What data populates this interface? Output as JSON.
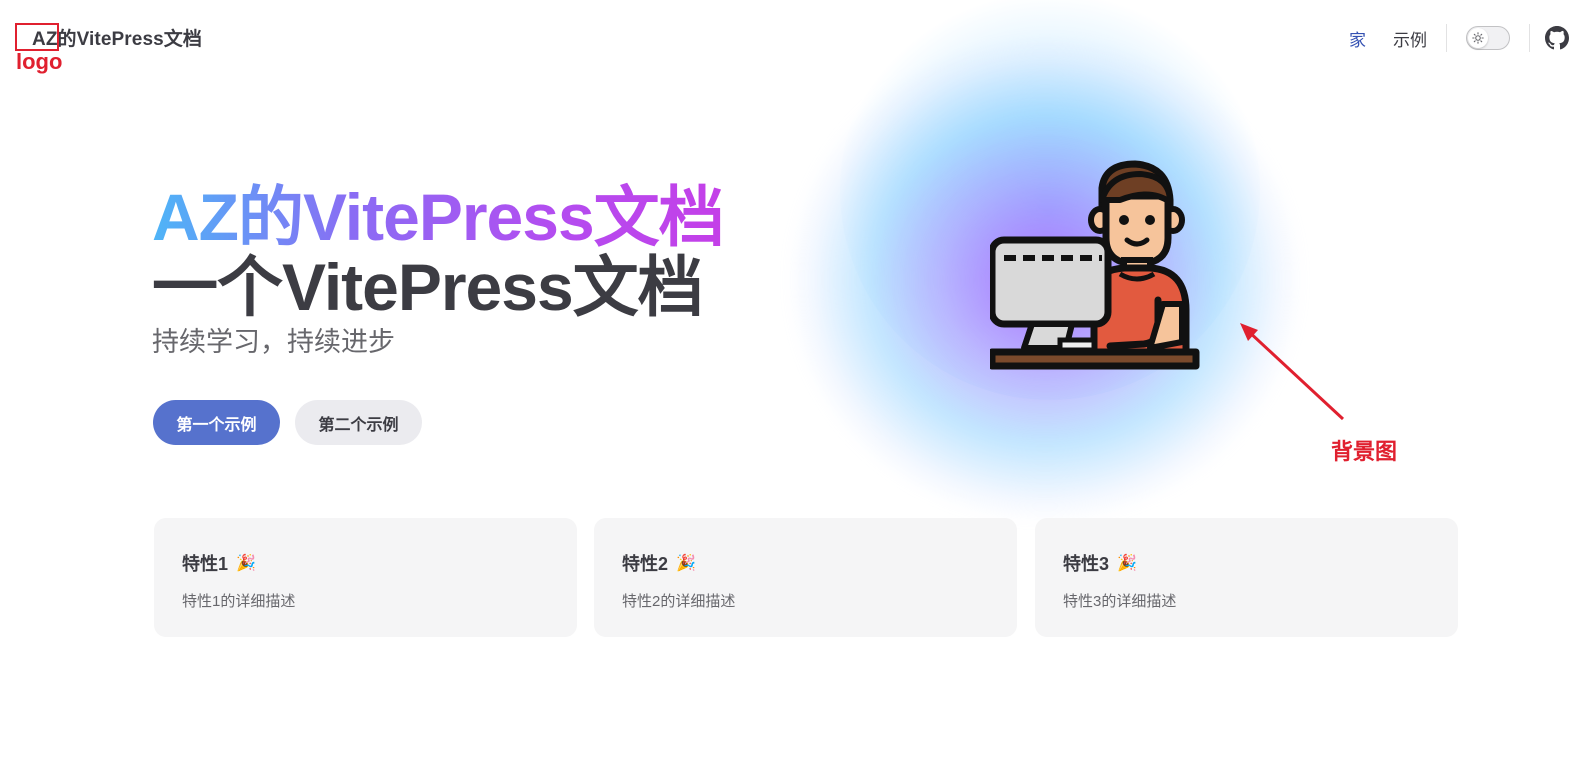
{
  "nav": {
    "site_title": "AZ的VitePress文档",
    "links": [
      {
        "label": "家",
        "active": true
      },
      {
        "label": "示例",
        "active": false
      }
    ],
    "icons": {
      "theme": "sun-icon",
      "social": "github-icon"
    }
  },
  "annotations": {
    "logo_label": "logo",
    "bg_label": "背景图",
    "color": "#e0202f"
  },
  "hero": {
    "name": "AZ的VitePress文档",
    "text": "一个VitePress文档",
    "tagline": "持续学习，持续进步",
    "actions": [
      {
        "label": "第一个示例",
        "theme": "brand"
      },
      {
        "label": "第二个示例",
        "theme": "alt"
      }
    ],
    "image": "programmer-at-computer-illustration"
  },
  "features": [
    {
      "title": "特性1",
      "icon": "party-popper-icon",
      "details": "特性1的详细描述"
    },
    {
      "title": "特性2",
      "icon": "party-popper-icon",
      "details": "特性2的详细描述"
    },
    {
      "title": "特性3",
      "icon": "party-popper-icon",
      "details": "特性3的详细描述"
    }
  ],
  "colors": {
    "brand": "#5672cd",
    "nav_active": "#3451b2",
    "text": "#3c3c43",
    "feature_bg": "#f5f5f6"
  }
}
